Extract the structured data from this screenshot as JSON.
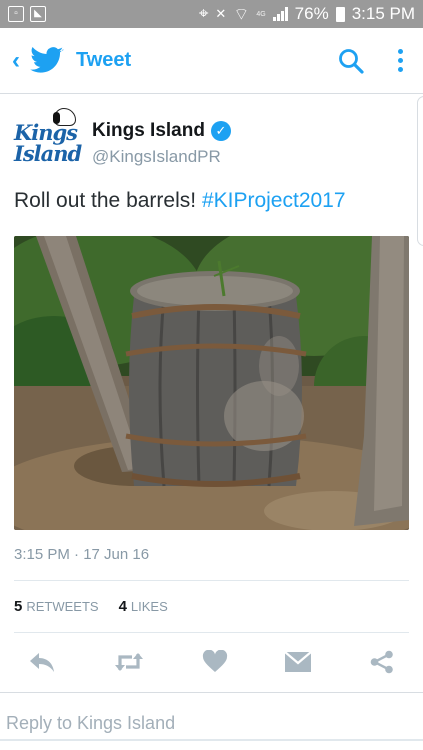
{
  "status_bar": {
    "left_icons": [
      "lock-screen-icon",
      "image-icon"
    ],
    "right_icons": [
      "location-icon",
      "mute-icon",
      "wifi-icon",
      "signal-icon",
      "battery-icon"
    ],
    "network": "4G",
    "battery": "76%",
    "time": "3:15 PM"
  },
  "app_bar": {
    "title": "Tweet",
    "back_icon": "chevron-left-icon",
    "logo_icon": "twitter-bird-icon",
    "search_icon": "search-icon",
    "menu_icon": "overflow-menu-icon"
  },
  "tweet": {
    "avatar_text": [
      "Kings",
      "Island"
    ],
    "name": "Kings Island",
    "verified": true,
    "handle": "@KingsIslandPR",
    "text": "Roll out the barrels! ",
    "hashtag": "#KIProject2017",
    "timestamp": "3:15 PM · 17 Jun 16",
    "retweets_count": "5",
    "retweets_label": "RETWEETS",
    "likes_count": "4",
    "likes_label": "LIKES"
  },
  "actions": [
    "reply-icon",
    "retweet-icon",
    "like-icon",
    "direct-message-icon",
    "share-icon"
  ],
  "reply": {
    "placeholder": "Reply to Kings Island"
  },
  "colors": {
    "accent": "#1da1f2",
    "status_bar": "#9a9a9a",
    "secondary_text": "#8899a6",
    "action_icon": "#aab8c2"
  }
}
